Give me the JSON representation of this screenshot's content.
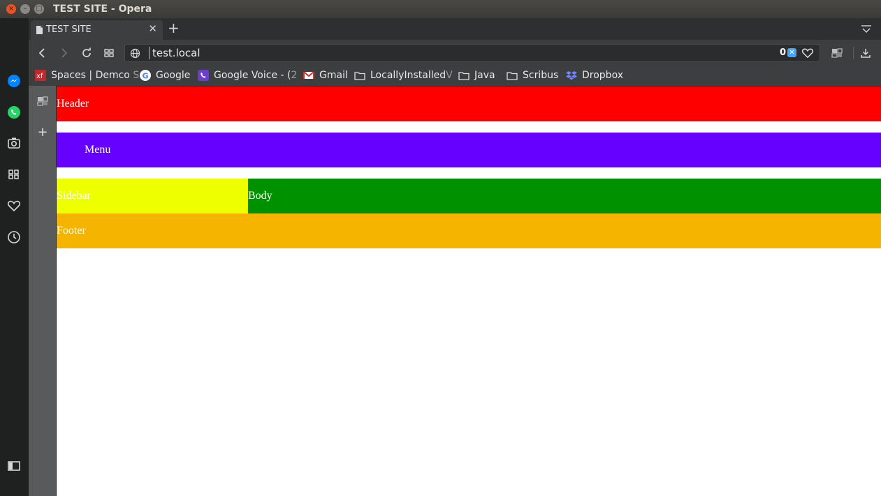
{
  "window": {
    "title": "TEST SITE - Opera",
    "close_glyph": "×",
    "minimize_glyph": "–",
    "maximize_glyph": "□"
  },
  "tabs": [
    {
      "title": "TEST SITE",
      "icon": "page-icon",
      "close_glyph": "✕",
      "active": true
    }
  ],
  "tabstrip": {
    "new_tab_glyph": "+"
  },
  "address_bar": {
    "url": "test.local",
    "blocked_count": "0",
    "shield_glyph": "✕"
  },
  "bookmarks": [
    {
      "label": "Spaces | Demco S",
      "icon": "xf-favicon",
      "faded_tail": true
    },
    {
      "label": "Google",
      "icon": "google-favicon"
    },
    {
      "label": "Google Voice - (2",
      "icon": "google-voice-favicon",
      "faded_tail": true
    },
    {
      "label": "Gmail",
      "icon": "gmail-favicon"
    },
    {
      "label": "LocallyInstalledV",
      "icon": "folder-icon",
      "faded_tail": true
    },
    {
      "label": "Java",
      "icon": "folder-icon"
    },
    {
      "label": "Scribus",
      "icon": "folder-icon"
    },
    {
      "label": "Dropbox",
      "icon": "dropbox-favicon"
    }
  ],
  "left_sidebar": [
    "messenger-icon",
    "whatsapp-icon",
    "camera-icon",
    "speed-dial-icon",
    "heart-icon",
    "history-icon",
    "sidebar-toggle-icon"
  ],
  "side_panel": {
    "add_glyph": "+"
  },
  "page": {
    "header": "Header",
    "menu": "Menu",
    "sidebar": "Sidebar",
    "body": "Body",
    "footer": "Footer"
  },
  "colors": {
    "header": "#ff0000",
    "menu": "#6600ff",
    "sidebar": "#eeff00",
    "body": "#009100",
    "footer": "#f5b400",
    "page_bg": "#ffffff"
  }
}
